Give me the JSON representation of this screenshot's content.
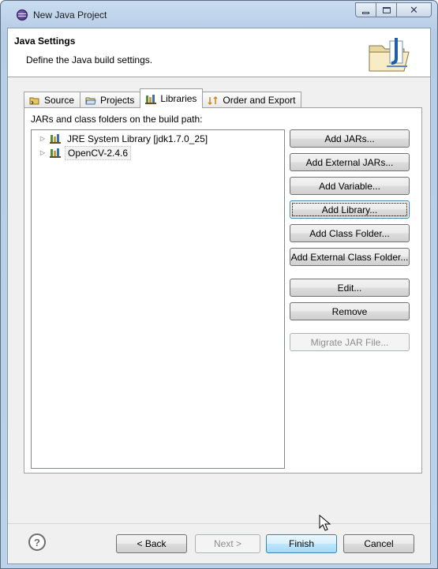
{
  "window": {
    "title": "New Java Project"
  },
  "header": {
    "title": "Java Settings",
    "description": "Define the Java build settings."
  },
  "tabs": [
    {
      "label": "Source",
      "icon": "source-folder-icon"
    },
    {
      "label": "Projects",
      "icon": "projects-icon"
    },
    {
      "label": "Libraries",
      "icon": "libraries-icon",
      "active": true
    },
    {
      "label": "Order and Export",
      "icon": "order-export-icon"
    }
  ],
  "panel": {
    "label": "JARs and class folders on the build path:",
    "tree": [
      {
        "label": "JRE System Library [jdk1.7.0_25]"
      },
      {
        "label": "OpenCV-2.4.6",
        "selected": true
      }
    ],
    "buttons": {
      "add_jars": "Add JARs...",
      "add_external_jars": "Add External JARs...",
      "add_variable": "Add Variable...",
      "add_library": "Add Library...",
      "add_class_folder": "Add Class Folder...",
      "add_external_class_folder": "Add External Class Folder...",
      "edit": "Edit...",
      "remove": "Remove",
      "migrate_jar": "Migrate JAR File..."
    }
  },
  "footer": {
    "help": "?",
    "back": "< Back",
    "next": "Next >",
    "finish": "Finish",
    "cancel": "Cancel"
  },
  "colors": {
    "accent": "#3c7fb1",
    "title_bar": "#c9dcf0",
    "dialog_bg": "#f0f0f0"
  }
}
